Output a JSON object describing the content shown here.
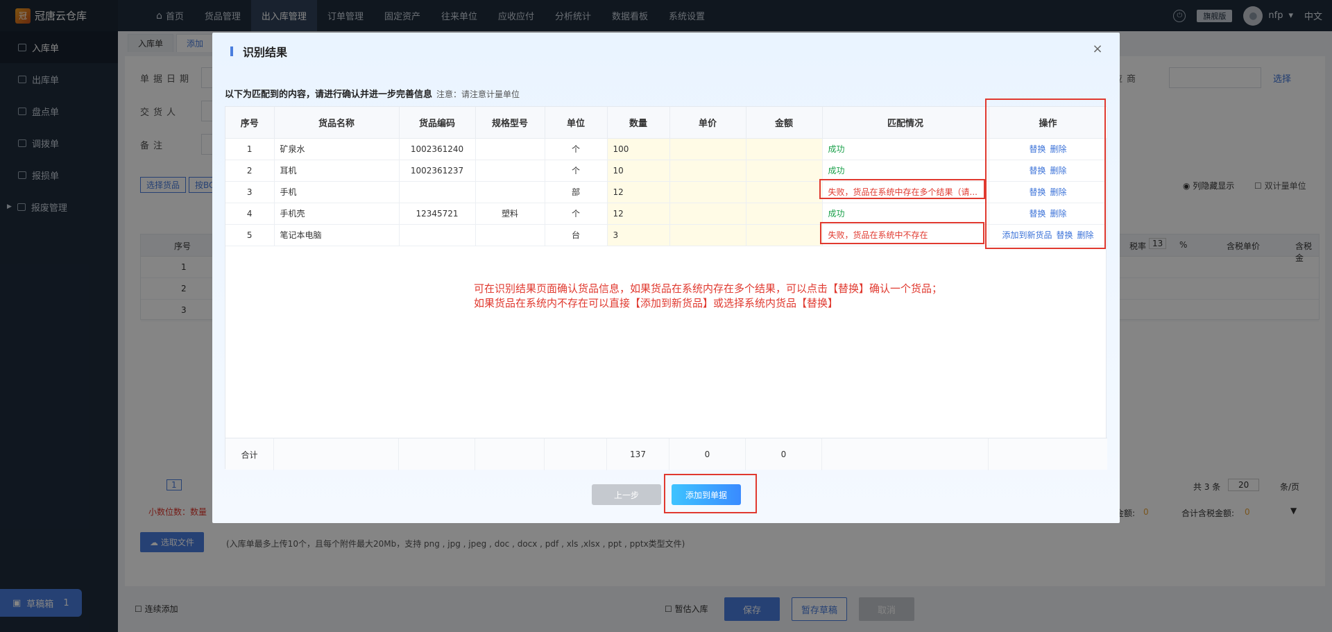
{
  "app": {
    "logo_text": "冠唐云仓库",
    "logo_char": "冠"
  },
  "nav": {
    "home": "首页",
    "items": [
      "货品管理",
      "出入库管理",
      "订单管理",
      "固定资产",
      "往来单位",
      "应收应付",
      "分析统计",
      "数据看板",
      "系统设置"
    ]
  },
  "topright": {
    "edition": "旗舰版",
    "user": "nfp",
    "lang": "中文"
  },
  "sidebar": {
    "items": [
      "入库单",
      "出库单",
      "盘点单",
      "调拨单",
      "报损单",
      "报废管理"
    ],
    "draft_label": "草稿箱",
    "draft_count": "1"
  },
  "page": {
    "tabs": [
      "入库单",
      "添加"
    ],
    "fields": {
      "date": "单据日期",
      "handler": "交货人",
      "remark": "备注",
      "supplier": "应商",
      "select_link": "选择"
    },
    "buttons": {
      "select_goods": "选择货品",
      "by_bom": "按BO"
    },
    "options": {
      "hide_cols": "列隐藏显示",
      "dual_unit": "双计量单位"
    },
    "grid_header": {
      "seq": "序号",
      "tax": "税率",
      "tax_val": "13",
      "pct": "%",
      "tax_price": "含税单价",
      "tax_amount": "含税金"
    },
    "grid_rows": [
      "1",
      "2",
      "3"
    ],
    "pager": {
      "page": "1",
      "total": "共 3 条",
      "size": "20",
      "unit": "条/页"
    },
    "decimals_label": "小数位数：数量",
    "totals": {
      "amount_label": "金额:",
      "amount_val": "0",
      "tax_total_label": "合计含税金额:",
      "tax_total_val": "0"
    },
    "upload": {
      "button": "选取文件",
      "hint": "(入库单最多上传10个，且每个附件最大20Mb，支持 png , jpg , jpeg , doc , docx , pdf , xls ,xlsx , ppt , pptx类型文件)"
    },
    "bottom": {
      "continuous_add": "连续添加",
      "temp_in": "暂估入库",
      "save": "保存",
      "save_draft": "暂存草稿",
      "cancel": "取消"
    }
  },
  "dialog": {
    "title": "识别结果",
    "intro": "以下为匹配到的内容，请进行确认并进一步完善信息",
    "note": "注意：请注意计量单位",
    "columns": [
      "序号",
      "货品名称",
      "货品编码",
      "规格型号",
      "单位",
      "数量",
      "单价",
      "金额",
      "匹配情况",
      "操作"
    ],
    "rows": [
      {
        "seq": "1",
        "name": "矿泉水",
        "code": "1002361240",
        "spec": "",
        "unit": "个",
        "qty": "100",
        "price": "",
        "amount": "",
        "match": "成功",
        "ok": true
      },
      {
        "seq": "2",
        "name": "耳机",
        "code": "1002361237",
        "spec": "",
        "unit": "个",
        "qty": "10",
        "price": "",
        "amount": "",
        "match": "成功",
        "ok": true
      },
      {
        "seq": "3",
        "name": "手机",
        "code": "",
        "spec": "",
        "unit": "部",
        "qty": "12",
        "price": "",
        "amount": "",
        "match": "失败，货品在系统中存在多个结果（请...",
        "ok": false
      },
      {
        "seq": "4",
        "name": "手机壳",
        "code": "12345721",
        "spec": "塑料",
        "unit": "个",
        "qty": "12",
        "price": "",
        "amount": "",
        "match": "成功",
        "ok": true
      },
      {
        "seq": "5",
        "name": "笔记本电脑",
        "code": "",
        "spec": "",
        "unit": "台",
        "qty": "3",
        "price": "",
        "amount": "",
        "match": "失败，货品在系统中不存在",
        "ok": false
      }
    ],
    "ops": {
      "replace": "替换",
      "delete": "删除",
      "add_new": "添加到新货品"
    },
    "summary": {
      "label": "合计",
      "qty": "137",
      "price": "0",
      "amount": "0"
    },
    "annotation_line1": "可在识别结果页面确认货品信息，如果货品在系统内存在多个结果，可以点击【替换】确认一个货品；",
    "annotation_line2": "如果货品在系统内不存在可以直接【添加到新货品】或选择系统内货品【替换】",
    "buttons": {
      "prev": "上一步",
      "add": "添加到单据"
    },
    "close": "×"
  },
  "colors": {
    "accent": "#4a7ede",
    "success": "#1aa04a",
    "error": "#e0392f",
    "highlight": "#fffbe6"
  }
}
